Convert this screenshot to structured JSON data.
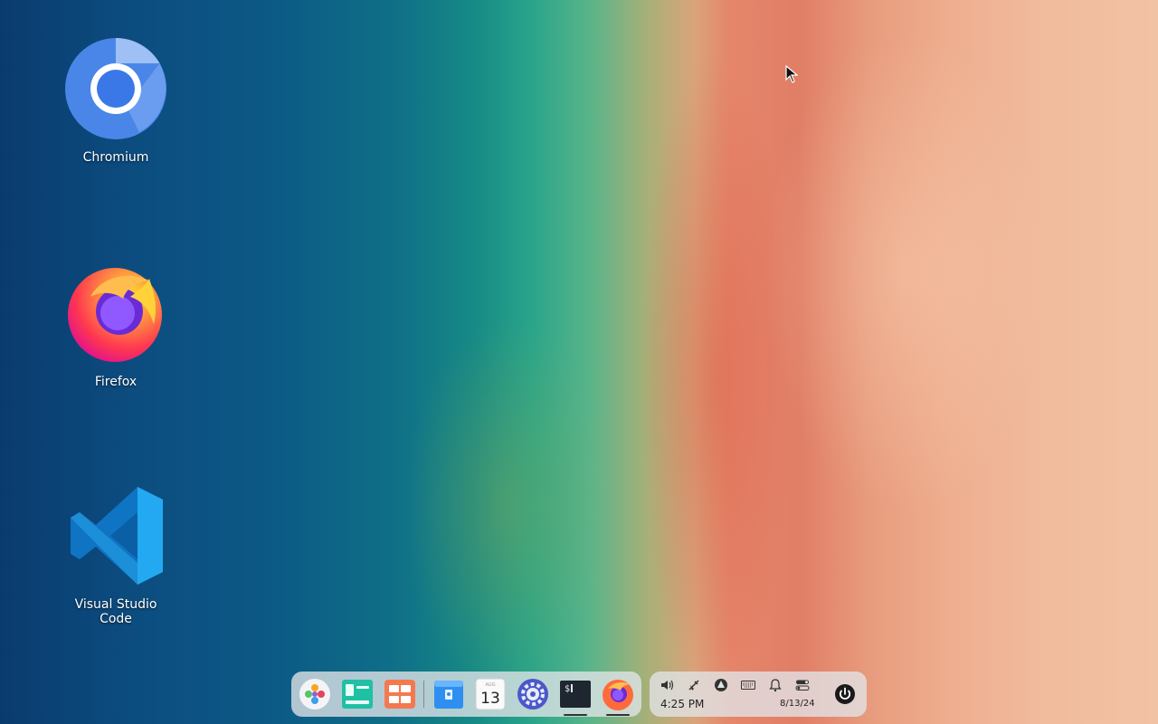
{
  "desktop": {
    "icons": [
      {
        "label": "Chromium",
        "icon": "chromium-icon"
      },
      {
        "label": "Firefox",
        "icon": "firefox-icon"
      },
      {
        "label": "Visual Studio Code",
        "icon": "vscode-icon"
      }
    ]
  },
  "dock": {
    "items": [
      {
        "name": "launcher",
        "icon": "launcher-icon"
      },
      {
        "name": "multitasking-view",
        "icon": "multitasking-icon"
      },
      {
        "name": "show-desktop",
        "icon": "show-desktop-icon"
      },
      {
        "name": "file-manager",
        "icon": "file-manager-icon"
      },
      {
        "name": "calendar",
        "icon": "calendar-icon",
        "day": "13",
        "month": "AUG"
      },
      {
        "name": "control-center",
        "icon": "settings-icon"
      },
      {
        "name": "terminal",
        "icon": "terminal-icon",
        "prompt": "$"
      },
      {
        "name": "firefox",
        "icon": "firefox-icon"
      }
    ]
  },
  "tray": {
    "icons": [
      "volume-icon",
      "network-disconnected-icon",
      "dock-icon",
      "keyboard-icon",
      "notification-icon",
      "toggle-icon"
    ],
    "time": "4:25 PM",
    "date": "8/13/24",
    "power_icon": "power-icon"
  },
  "colors": {
    "dock_bg": "#e1e4e8",
    "firefox_orange": "#ff7139",
    "chromium_blue": "#4a86e8",
    "vscode_blue": "#23a9f2"
  }
}
